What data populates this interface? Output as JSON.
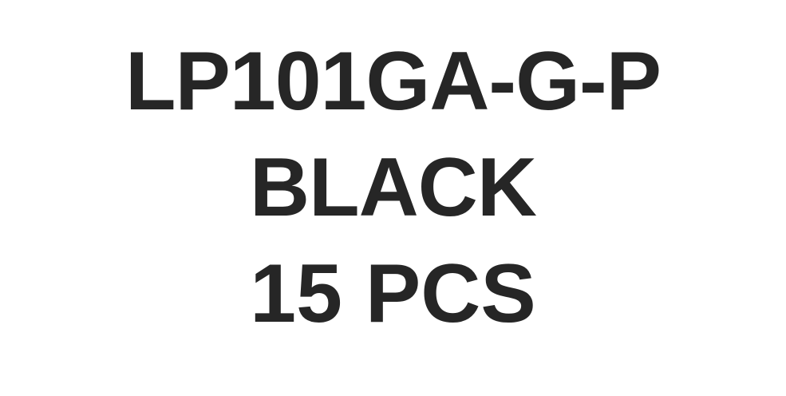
{
  "label": {
    "model": "LP101GA-G-P",
    "color": "BLACK",
    "quantity": "15 PCS"
  },
  "colors": {
    "text": "#262626",
    "background": "#ffffff"
  }
}
